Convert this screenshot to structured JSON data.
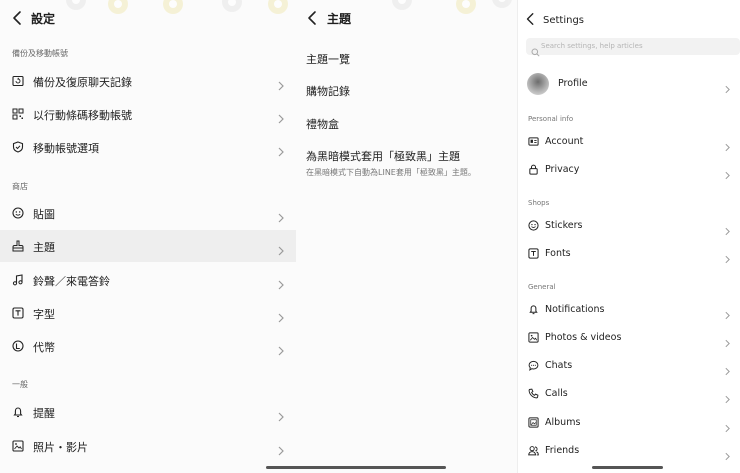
{
  "left": {
    "title": "設定",
    "sections": [
      {
        "label": "備份及移動帳號",
        "items": [
          "備份及復原聊天記錄",
          "以行動條碼移動帳號",
          "移動帳號選項"
        ]
      },
      {
        "label": "商店",
        "items": [
          "貼圖",
          "主題",
          "鈴聲／來電答鈴",
          "字型",
          "代幣"
        ]
      },
      {
        "label": "一般",
        "items": [
          "提醒",
          "照片・影片"
        ]
      }
    ],
    "selected_item": "主題"
  },
  "middle": {
    "title": "主題",
    "items": [
      "主題一覽",
      "購物記錄",
      "禮物盒",
      "為黑暗模式套用「極致黑」主題"
    ],
    "dark_mode_description": "在黑暗模式下自動為LINE套用「極致黑」主題。"
  },
  "right": {
    "title": "Settings",
    "search_placeholder": "Search settings, help articles",
    "profile_label": "Profile",
    "sections": [
      {
        "label": "Personal info",
        "items": [
          "Account",
          "Privacy"
        ]
      },
      {
        "label": "Shops",
        "items": [
          "Stickers",
          "Fonts"
        ]
      },
      {
        "label": "General",
        "items": [
          "Notifications",
          "Photos & videos",
          "Chats",
          "Calls",
          "Albums",
          "Friends"
        ]
      }
    ]
  },
  "colors": {
    "selected_row": "#eeeeee",
    "chevron": "#9a9a9a",
    "decor": "#f3eec7"
  },
  "icons": {
    "left": [
      "backup-icon",
      "qr-code-icon",
      "shield-icon",
      "sticker-face-icon",
      "theme-brush-icon",
      "music-note-icon",
      "font-t-icon",
      "coin-icon",
      "bell-icon",
      "photo-icon"
    ],
    "right": [
      "account-card-icon",
      "lock-icon",
      "sticker-face-icon",
      "font-t-icon",
      "bell-icon",
      "photo-icon",
      "chat-bubble-icon",
      "phone-icon",
      "album-icon",
      "friends-icon"
    ]
  }
}
